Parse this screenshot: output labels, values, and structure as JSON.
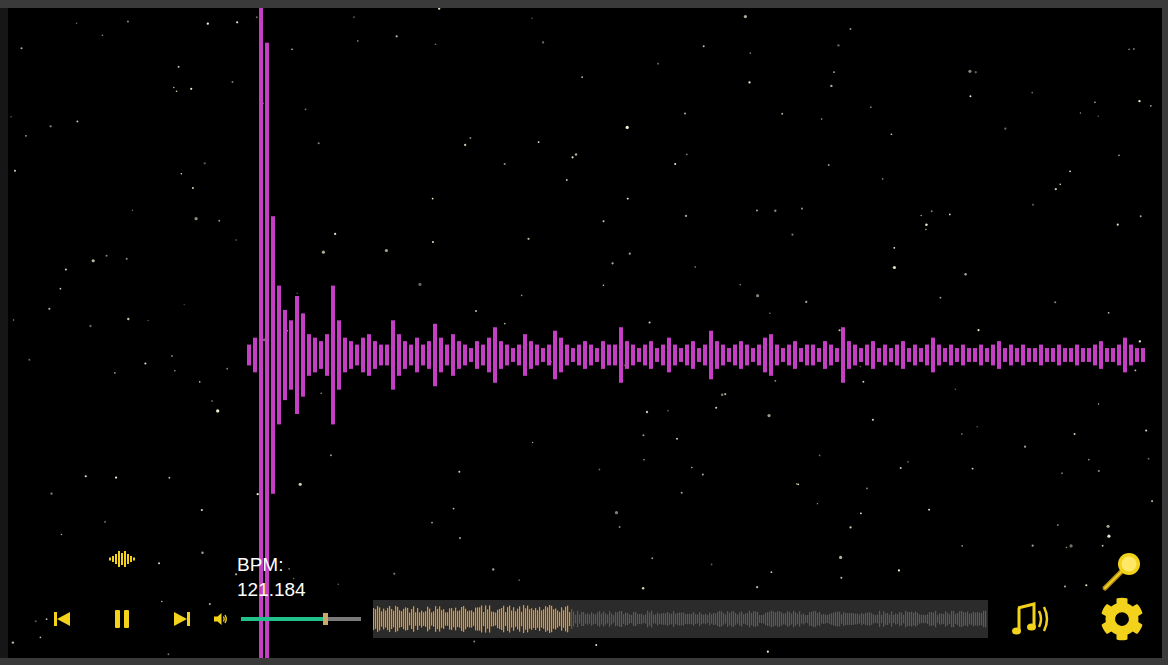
{
  "visualizer": {
    "waveform": [
      0.03,
      0.05,
      1,
      0.9,
      0.4,
      0.2,
      0.13,
      0.1,
      0.17,
      0.12,
      0.06,
      0.05,
      0.04,
      0.06,
      0.2,
      0.1,
      0.05,
      0.04,
      0.03,
      0.05,
      0.06,
      0.04,
      0.03,
      0.03,
      0.1,
      0.06,
      0.04,
      0.03,
      0.05,
      0.03,
      0.04,
      0.09,
      0.05,
      0.03,
      0.06,
      0.04,
      0.03,
      0.02,
      0.04,
      0.03,
      0.05,
      0.08,
      0.04,
      0.03,
      0.02,
      0.03,
      0.06,
      0.04,
      0.03,
      0.02,
      0.03,
      0.07,
      0.05,
      0.03,
      0.02,
      0.03,
      0.04,
      0.03,
      0.02,
      0.04,
      0.03,
      0.03,
      0.08,
      0.04,
      0.03,
      0.02,
      0.03,
      0.04,
      0.02,
      0.03,
      0.05,
      0.03,
      0.02,
      0.03,
      0.04,
      0.02,
      0.03,
      0.07,
      0.04,
      0.03,
      0.02,
      0.03,
      0.04,
      0.03,
      0.02,
      0.03,
      0.05,
      0.06,
      0.03,
      0.02,
      0.03,
      0.04,
      0.02,
      0.03,
      0.03,
      0.02,
      0.04,
      0.03,
      0.02,
      0.08,
      0.04,
      0.03,
      0.02,
      0.03,
      0.04,
      0.02,
      0.03,
      0.02,
      0.03,
      0.04,
      0.02,
      0.03,
      0.02,
      0.03,
      0.05,
      0.03,
      0.02,
      0.03,
      0.02,
      0.03,
      0.02,
      0.02,
      0.03,
      0.02,
      0.03,
      0.04,
      0.02,
      0.03,
      0.02,
      0.03,
      0.02,
      0.02,
      0.03,
      0.02,
      0.02,
      0.03,
      0.02,
      0.02,
      0.03,
      0.02,
      0.02,
      0.03,
      0.04,
      0.02,
      0.02,
      0.03,
      0.05,
      0.03,
      0.02,
      0.02
    ]
  },
  "player": {
    "playing": true,
    "bpm": {
      "label": "BPM:",
      "value": "121.184"
    },
    "volume": {
      "level": 0.7
    },
    "progress": {
      "level": 0.32
    }
  }
}
